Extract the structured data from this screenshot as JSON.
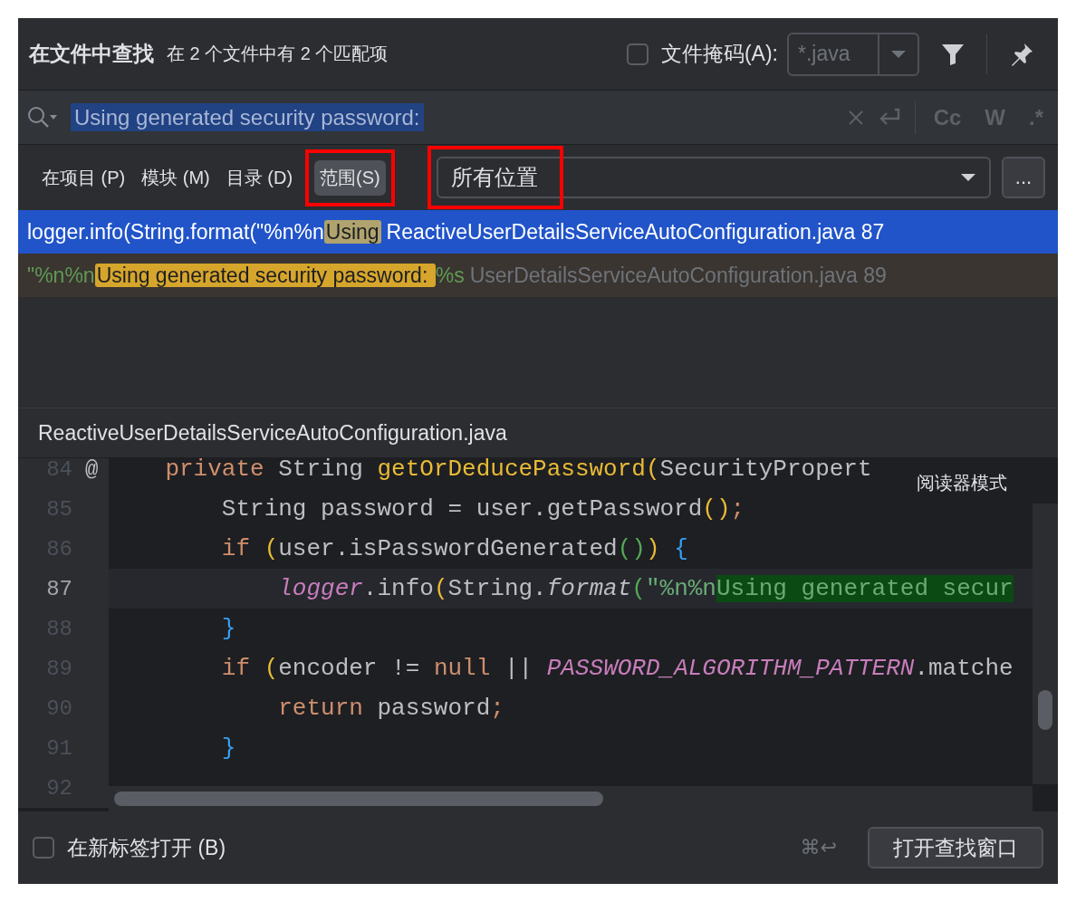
{
  "header": {
    "title": "在文件中查找",
    "summary": "在 2 个文件中有 2 个匹配项",
    "file_mask": {
      "label": "文件掩码(A):",
      "checked": false,
      "value": "*.java"
    }
  },
  "search": {
    "value": "Using generated security password:",
    "options": [
      {
        "text": "Cc",
        "selected": false
      },
      {
        "text": "W",
        "selected": false
      },
      {
        "text": ".*",
        "selected": false
      }
    ]
  },
  "scopes": [
    {
      "label": "在项目 (P)",
      "selected": false,
      "annotated": false
    },
    {
      "label": "模块 (M)",
      "selected": false,
      "annotated": false
    },
    {
      "label": "目录 (D)",
      "selected": false,
      "annotated": false
    },
    {
      "label": "范围(S)",
      "selected": true,
      "annotated": true
    }
  ],
  "scope_dropdown": {
    "value": "所有位置",
    "annotated": true,
    "more": "..."
  },
  "results": [
    {
      "prefix": "logger.info(String.format(\"%n%n",
      "match": "Using ",
      "file": "ReactiveUserDetailsServiceAutoConfiguration.java",
      "line": "87",
      "selected": true
    },
    {
      "prefix": "\"%n%n",
      "match": "Using generated security password: ",
      "suffix": "%s",
      "file": "UserDetailsServiceAutoConfiguration.java",
      "line": "89",
      "selected": false
    }
  ],
  "preview": {
    "file": "ReactiveUserDetailsServiceAutoConfiguration.java",
    "reader_mode": "阅读器模式",
    "lines": [
      {
        "number": "84",
        "marker": "@",
        "current": false,
        "tokens": [
          {
            "kind": "keyword",
            "text": "    private"
          },
          {
            "kind": "plain",
            "text": " String "
          },
          {
            "kind": "decl",
            "text": "getOrDeducePassword"
          },
          {
            "kind": "paren1",
            "text": "("
          },
          {
            "kind": "plain",
            "text": "SecurityPropert"
          }
        ]
      },
      {
        "number": "85",
        "current": false,
        "tokens": [
          {
            "kind": "plain",
            "text": "        String password = user.getPassword"
          },
          {
            "kind": "paren1",
            "text": "()"
          },
          {
            "kind": "keyword",
            "text": ";"
          }
        ]
      },
      {
        "number": "86",
        "current": false,
        "tokens": [
          {
            "kind": "keyword",
            "text": "        if"
          },
          {
            "kind": "paren1",
            "text": " ("
          },
          {
            "kind": "plain",
            "text": "user.isPasswordGenerated"
          },
          {
            "kind": "paren2",
            "text": "()"
          },
          {
            "kind": "paren1",
            "text": ")"
          },
          {
            "kind": "paren3",
            "text": " {"
          }
        ]
      },
      {
        "number": "87",
        "current": true,
        "tokens": [
          {
            "kind": "static",
            "text": "            logger"
          },
          {
            "kind": "plain",
            "text": ".info"
          },
          {
            "kind": "paren1",
            "text": "("
          },
          {
            "kind": "plain",
            "text": "String."
          },
          {
            "kind": "italic",
            "text": "format"
          },
          {
            "kind": "paren2",
            "text": "("
          },
          {
            "kind": "string",
            "text": "\"%n%n"
          },
          {
            "kind": "match",
            "text": "Using generated secur"
          }
        ]
      },
      {
        "number": "88",
        "current": false,
        "tokens": [
          {
            "kind": "paren3",
            "text": "        }"
          }
        ]
      },
      {
        "number": "89",
        "current": false,
        "tokens": [
          {
            "kind": "keyword",
            "text": "        if"
          },
          {
            "kind": "paren1",
            "text": " ("
          },
          {
            "kind": "plain",
            "text": "encoder != "
          },
          {
            "kind": "keyword",
            "text": "null"
          },
          {
            "kind": "plain",
            "text": " || "
          },
          {
            "kind": "static",
            "text": "PASSWORD_ALGORITHM_PATTERN"
          },
          {
            "kind": "plain",
            "text": ".matche"
          }
        ]
      },
      {
        "number": "90",
        "current": false,
        "tokens": [
          {
            "kind": "keyword",
            "text": "            return"
          },
          {
            "kind": "plain",
            "text": " password"
          },
          {
            "kind": "keyword",
            "text": ";"
          }
        ]
      },
      {
        "number": "91",
        "current": false,
        "tokens": [
          {
            "kind": "paren3",
            "text": "        }"
          }
        ]
      },
      {
        "number": "92",
        "current": false
      }
    ]
  },
  "footer": {
    "new_tab": {
      "label": "在新标签打开 (B)",
      "checked": false
    },
    "shortcut": "⌘↩",
    "open_button": "打开查找窗口"
  }
}
